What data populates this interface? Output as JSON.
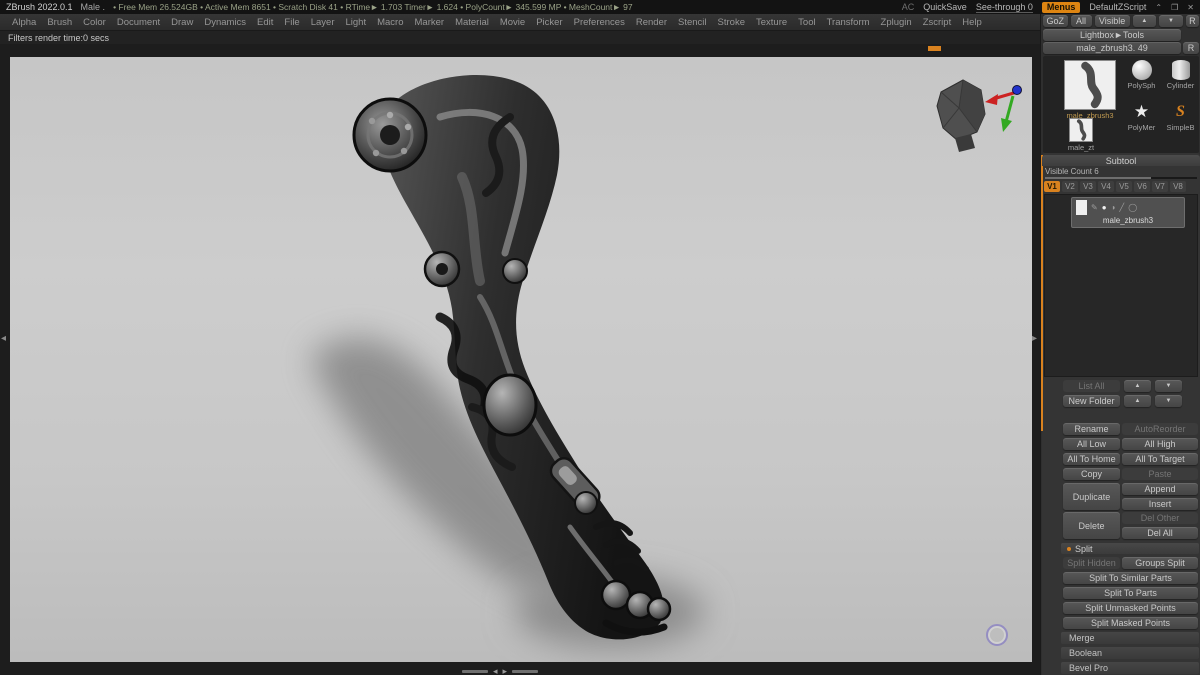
{
  "colors": {
    "accent_orange": "#d9821f",
    "canvas_gray": "#c7c7c7"
  },
  "icons": {
    "minimize": "⌃",
    "restore": "❒",
    "close": "✕",
    "up_arrow": "▲",
    "down_arrow": "▼",
    "left_arrow": "◂",
    "right_arrow": "▸",
    "star": "★",
    "letter_s": "S",
    "edit": "✎",
    "eye": "●",
    "paint": "◑",
    "mask": "╱",
    "ghost": "◯"
  },
  "titlebar": {
    "app_title": "ZBrush 2022.0.1",
    "doc_title": "Male .",
    "stats_text": "• Free Mem 26.524GB • Active Mem 8651 • Scratch Disk 41 • RTime► 1.703 Timer► 1.624 • PolyCount► 345.599 MP • MeshCount► 97",
    "ac": "AC",
    "quicksave": "QuickSave",
    "seethrough": "See-through 0",
    "menus": "Menus",
    "zscript": "DefaultZScript"
  },
  "menubar": {
    "items": [
      "Alpha",
      "Brush",
      "Color",
      "Document",
      "Draw",
      "Dynamics",
      "Edit",
      "File",
      "Layer",
      "Light",
      "Macro",
      "Marker",
      "Material",
      "Movie",
      "Picker",
      "Preferences",
      "Render",
      "Stencil",
      "Stroke",
      "Texture",
      "Tool",
      "Transform",
      "Zplugin",
      "Zscript",
      "Help"
    ]
  },
  "statusbar": {
    "text": "Filters render time:0 secs"
  },
  "tool_panel": {
    "top_buttons": [
      "GoZ",
      "All",
      "Visible"
    ],
    "r_button": "R",
    "lightbox": "Lightbox►Tools",
    "tool_name": "male_zbrush3. 49",
    "tool_r": "R",
    "thumbnails": [
      {
        "label": "male_zbrush3",
        "type": "big-mesh"
      },
      {
        "label": "PolySph",
        "type": "sphere"
      },
      {
        "label": "Cylinder",
        "type": "cylinder"
      },
      {
        "label": "PolyMer",
        "type": "star"
      },
      {
        "label": "SimpleB",
        "type": "letter-s"
      },
      {
        "label": "male_zt",
        "type": "small-mesh"
      }
    ]
  },
  "subtool": {
    "header": "Subtool",
    "visible_count": "Visible Count 6",
    "tabs": [
      "V1",
      "V2",
      "V3",
      "V4",
      "V5",
      "V6",
      "V7",
      "V8"
    ],
    "active_tab": "V1",
    "item_label": "male_zbrush3",
    "list_all": "List All",
    "new_folder": "New Folder",
    "button_pairs": [
      [
        {
          "label": "Rename",
          "enabled": true
        },
        {
          "label": "AutoReorder",
          "enabled": false
        }
      ],
      [
        {
          "label": "All Low",
          "enabled": true
        },
        {
          "label": "All High",
          "enabled": true
        }
      ],
      [
        {
          "label": "All To Home",
          "enabled": true
        },
        {
          "label": "All To Target",
          "enabled": true
        }
      ],
      [
        {
          "label": "Copy",
          "enabled": true
        },
        {
          "label": "Paste",
          "enabled": false
        }
      ]
    ],
    "tall_groups": [
      {
        "tall": {
          "label": "Duplicate",
          "enabled": true
        },
        "stack": [
          {
            "label": "Append",
            "enabled": true
          },
          {
            "label": "Insert",
            "enabled": true
          }
        ]
      },
      {
        "tall": {
          "label": "Delete",
          "enabled": true
        },
        "stack": [
          {
            "label": "Del Other",
            "enabled": false
          },
          {
            "label": "Del All",
            "enabled": true
          }
        ]
      }
    ],
    "split": {
      "header": "Split",
      "pair": [
        {
          "label": "Split Hidden",
          "enabled": false
        },
        {
          "label": "Groups Split",
          "enabled": true
        }
      ],
      "full": [
        "Split To Similar Parts",
        "Split To Parts",
        "Split Unmasked Points",
        "Split Masked Points"
      ],
      "sections": [
        "Merge",
        "Boolean",
        "Bevel Pro"
      ]
    }
  }
}
